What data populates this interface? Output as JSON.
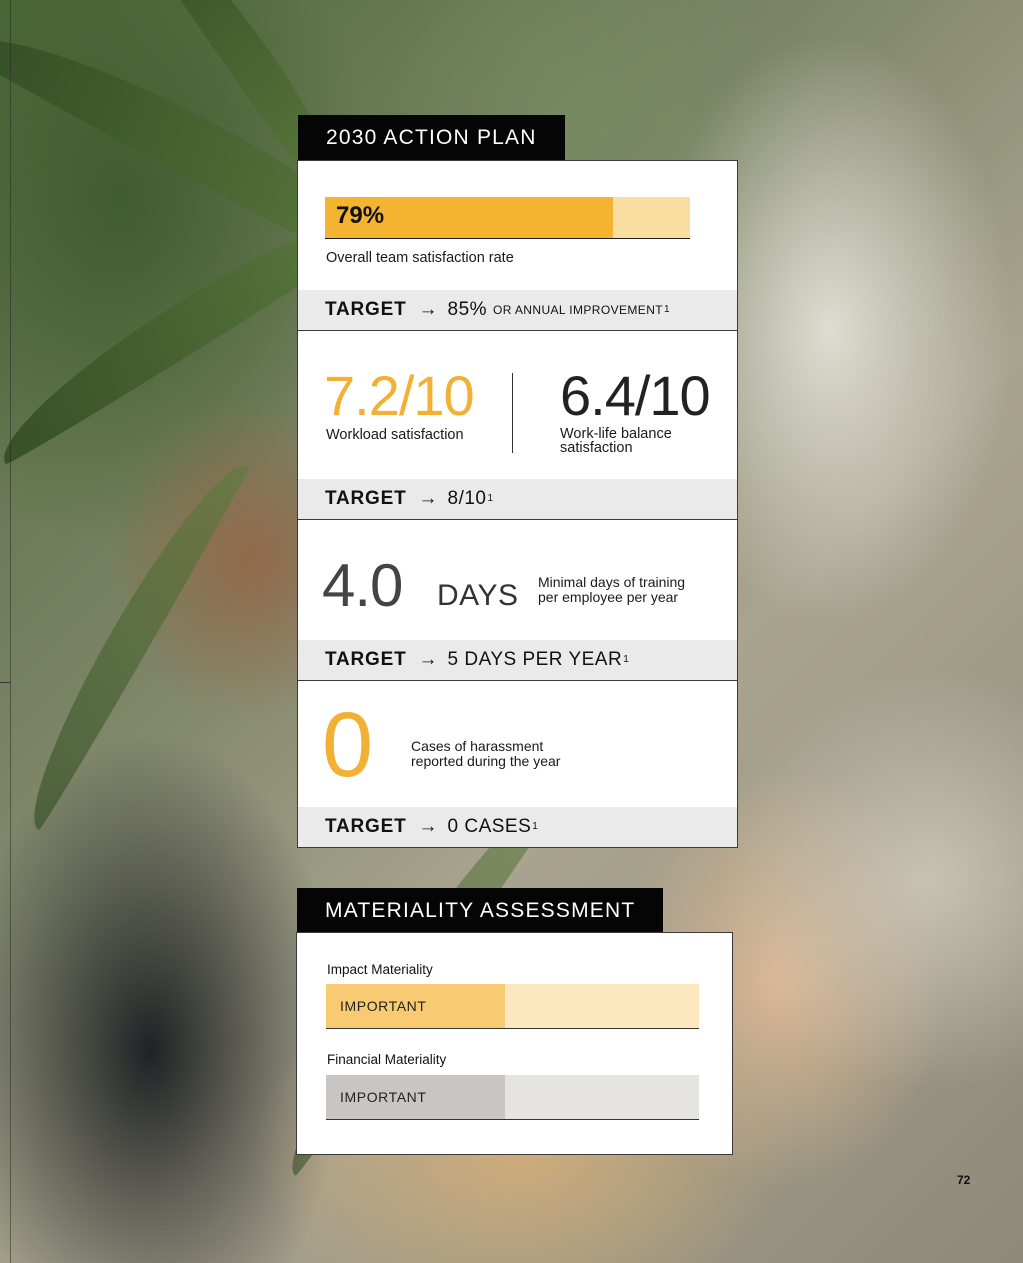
{
  "action_plan": {
    "title": "2030 ACTION PLAN",
    "satisfaction": {
      "value_label": "79%",
      "value": 79,
      "caption": "Overall team satisfaction rate",
      "target_label": "TARGET",
      "target_arrow": "→",
      "target_value": "85%",
      "target_suffix": "OR ANNUAL IMPROVEMENT",
      "footnote": "1"
    },
    "workload": {
      "value": "7.2/10",
      "caption": "Workload satisfaction",
      "worklife_value": "6.4/10",
      "worklife_caption_line1": "Work-life balance",
      "worklife_caption_line2": "satisfaction",
      "target_label": "TARGET",
      "target_arrow": "→",
      "target_value": "8/10",
      "footnote": "1"
    },
    "training": {
      "value": "4.0",
      "unit": "DAYS",
      "caption_line1": "Minimal days of training",
      "caption_line2": "per employee per year",
      "target_label": "TARGET",
      "target_arrow": "→",
      "target_value": "5 DAYS PER YEAR",
      "footnote": "1"
    },
    "harassment": {
      "value": "0",
      "caption_line1": "Cases of harassment",
      "caption_line2": "reported during the year",
      "target_label": "TARGET",
      "target_arrow": "→",
      "target_value": "0 CASES",
      "footnote": "1"
    }
  },
  "materiality": {
    "title": "MATERIALITY ASSESSMENT",
    "impact": {
      "label": "Impact Materiality",
      "level": "IMPORTANT",
      "fill_fraction": 0.48
    },
    "financial": {
      "label": "Financial Materiality",
      "level": "IMPORTANT",
      "fill_fraction": 0.48
    }
  },
  "colors": {
    "accent": "#f4b331",
    "accent_light": "#f9dea2",
    "impact_fill": "#f8ca72",
    "impact_rest": "#fde7bf",
    "financial_fill": "#c8c5c2",
    "financial_rest": "#e5e4e3"
  },
  "page_number": "72"
}
